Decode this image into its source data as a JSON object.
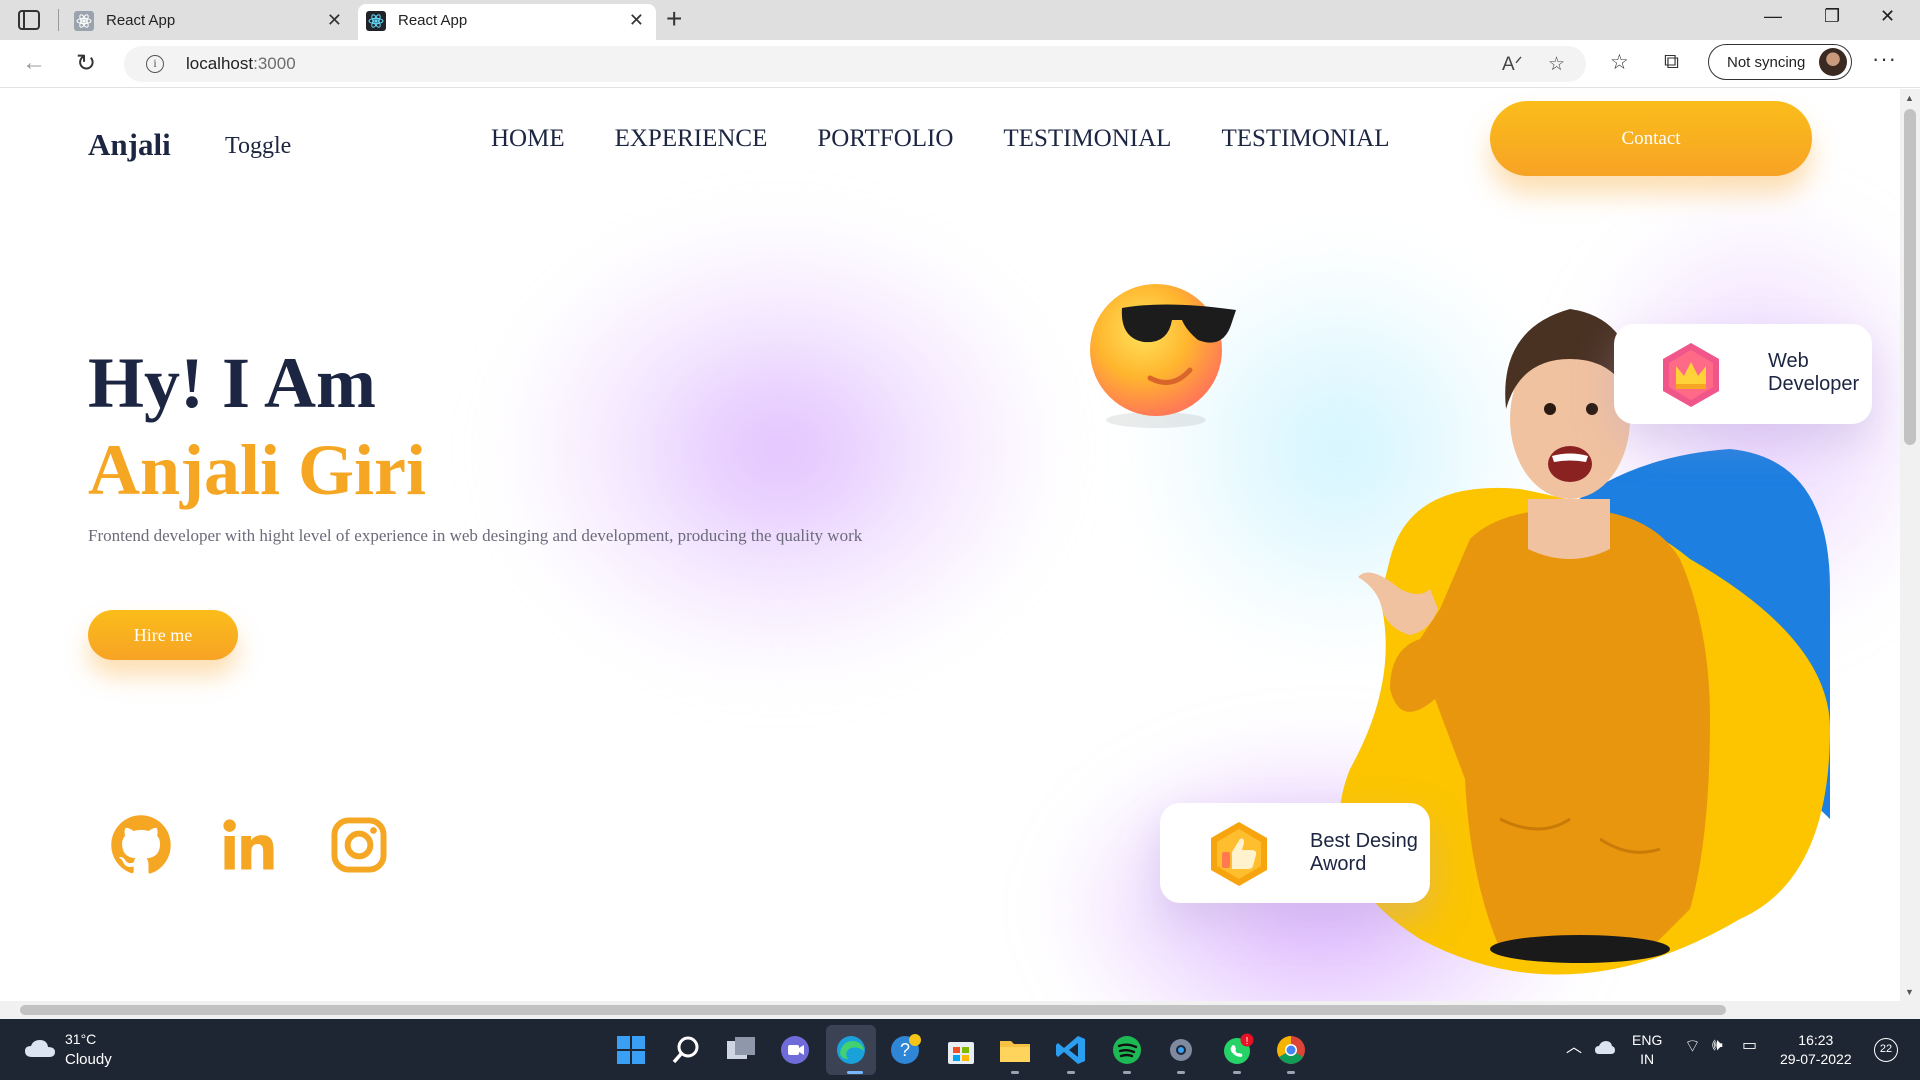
{
  "browser": {
    "tabs": [
      {
        "title": "React App",
        "active": false
      },
      {
        "title": "React App",
        "active": true
      }
    ],
    "address": {
      "host": "localhost",
      "port": ":3000"
    },
    "sync_label": "Not syncing"
  },
  "site": {
    "logo": "Anjali",
    "toggle": "Toggle",
    "nav": [
      "HOME",
      "EXPERIENCE",
      "PORTFOLIO",
      "TESTIMONIAL",
      "TESTIMONIAL"
    ],
    "contact_label": "Contact",
    "hero": {
      "line1": "Hy! I Am",
      "line2": "Anjali Giri",
      "description": "Frontend developer with hight level of experience in web desinging and development, producing the quality work",
      "hire_label": "Hire me"
    },
    "socials": [
      "github-icon",
      "linkedin-icon",
      "instagram-icon"
    ],
    "badges": {
      "web": {
        "line1": "Web",
        "line2": "Developer"
      },
      "award": {
        "line1": "Best Desing",
        "line2": "Aword"
      }
    },
    "colors": {
      "accent": "#f5a623",
      "navy": "#1c2541",
      "blue_blob": "#1d7fe0",
      "yellow_blob": "#fcc500"
    }
  },
  "taskbar": {
    "weather": {
      "temp": "31°C",
      "condition": "Cloudy"
    },
    "language": {
      "line1": "ENG",
      "line2": "IN"
    },
    "time": "16:23",
    "date": "29-07-2022",
    "notifications": "22"
  }
}
